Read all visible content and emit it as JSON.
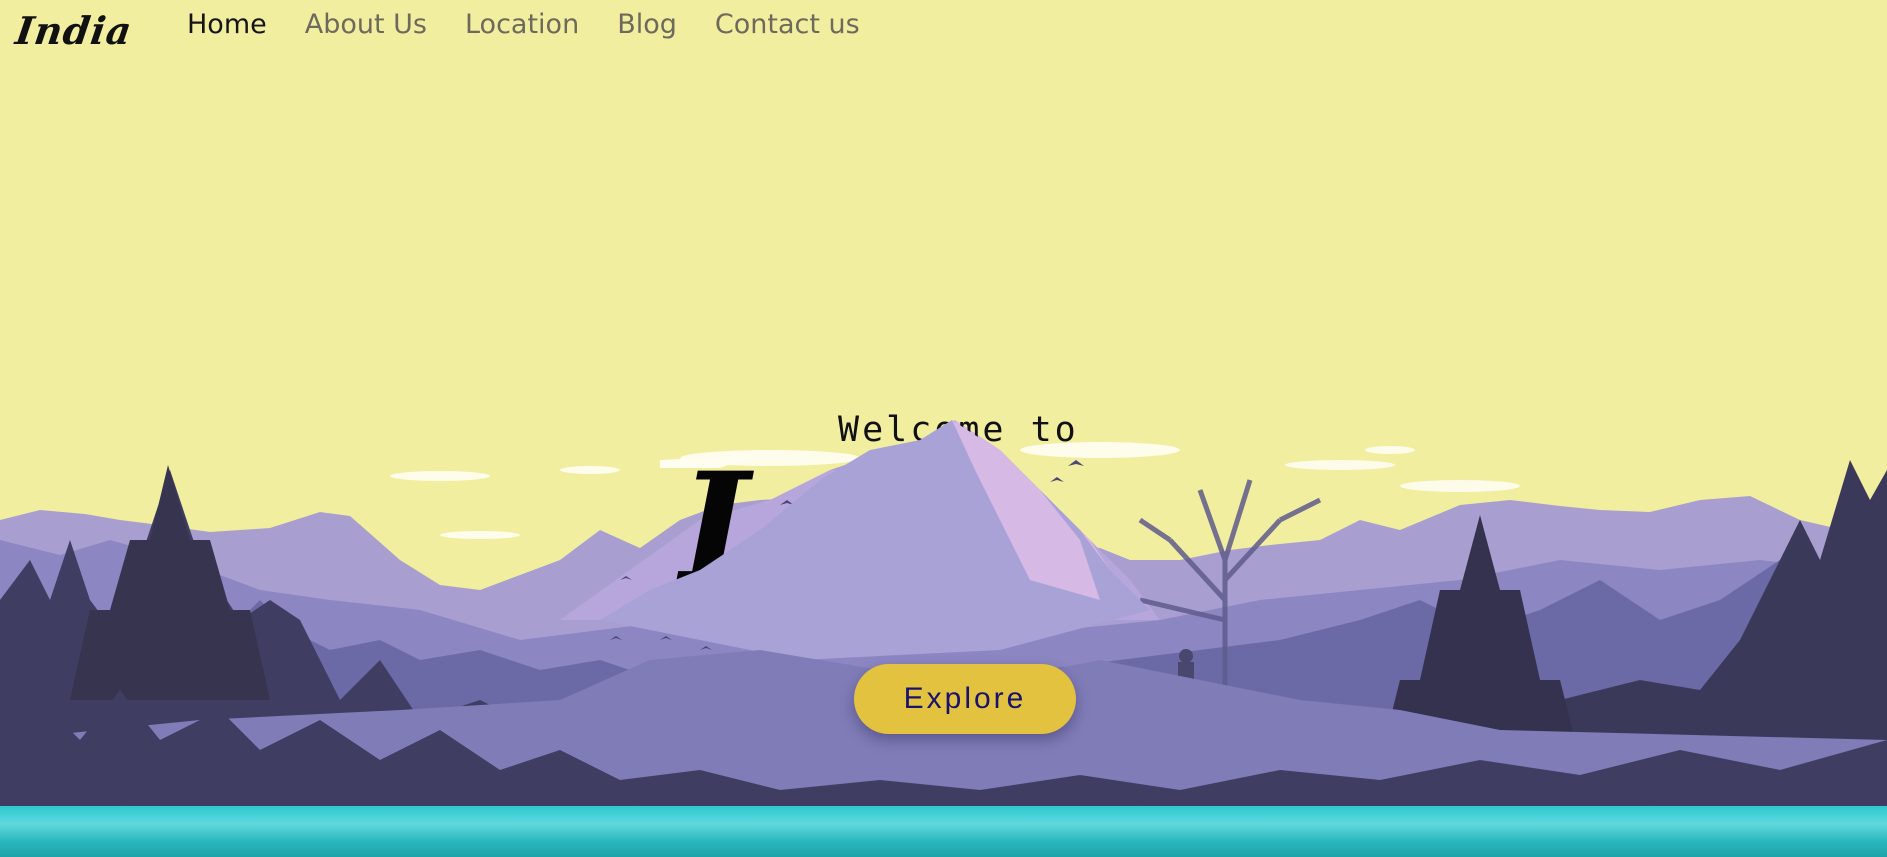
{
  "nav": {
    "logo": "India",
    "links": [
      {
        "label": "Home",
        "active": true
      },
      {
        "label": "About Us",
        "active": false
      },
      {
        "label": "Location",
        "active": false
      },
      {
        "label": "Blog",
        "active": false
      },
      {
        "label": "Contact us",
        "active": false
      }
    ]
  },
  "hero": {
    "welcome": "Welcome to",
    "title": "I",
    "explore_label": "Explore"
  },
  "colors": {
    "sky": "#f2ee9f",
    "button": "#e3c240",
    "button_text": "#18136e",
    "water": "#2cc9cf"
  }
}
